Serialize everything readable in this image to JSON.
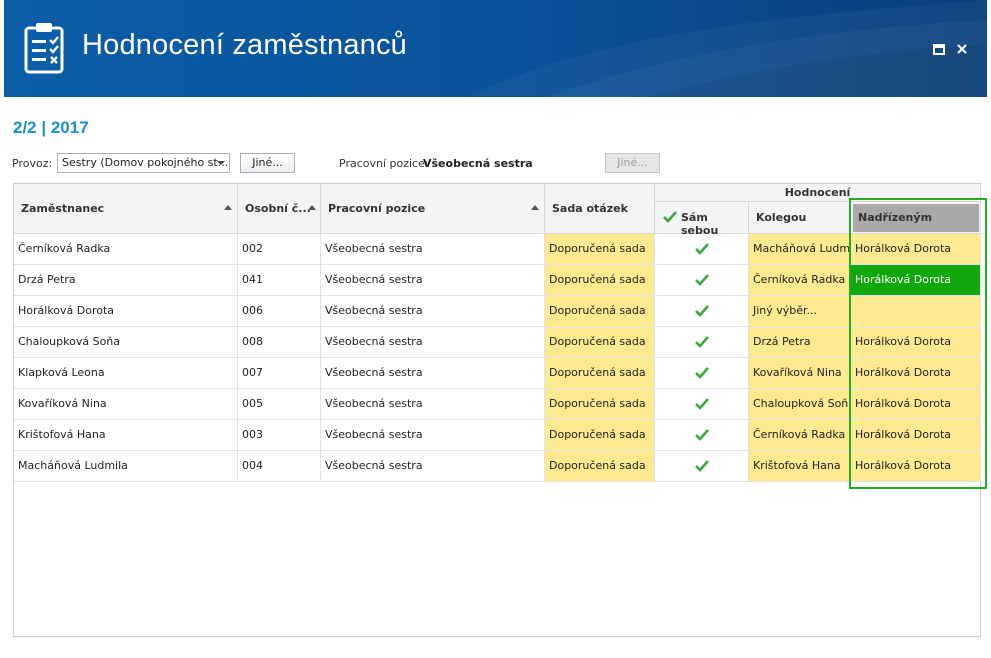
{
  "window": {
    "title": "Hodnocení zaměstnanců",
    "icon": "clipboard-checklist-icon",
    "maximize_icon": "maximize-icon",
    "close_icon": "close-icon"
  },
  "period": "2/2 | 2017",
  "filters": {
    "provoz_label": "Provoz:",
    "provoz_value": "Sestry (Domov pokojného st...",
    "provoz_other_button": "Jiné...",
    "position_label": "Pracovní pozice:",
    "position_value": "Všeobecná sestra",
    "position_other_button": "Jiné..."
  },
  "grid": {
    "headers": {
      "employee": "Zaměstnanec",
      "personal_no": "Osobní č...",
      "position": "Pracovní pozice",
      "question_set": "Sada otázek",
      "evaluation_group": "Hodnocení",
      "self": "Sám sebou",
      "colleague": "Kolegou",
      "supervisor": "Nadřízeným"
    },
    "rows": [
      {
        "employee": "Černíková Radka",
        "no": "002",
        "position": "Všeobecná sestra",
        "set": "Doporučená sada",
        "self": true,
        "colleague": "Macháňová Ludmila",
        "supervisor": "Horálková Dorota"
      },
      {
        "employee": "Drzá Petra",
        "no": "041",
        "position": "Všeobecná sestra",
        "set": "Doporučená sada",
        "self": true,
        "colleague": "Černíková Radka",
        "supervisor": "Horálková Dorota"
      },
      {
        "employee": "Horálková Dorota",
        "no": "006",
        "position": "Všeobecná sestra",
        "set": "Doporučená sada",
        "self": true,
        "colleague": "Jiný výběr...",
        "supervisor": ""
      },
      {
        "employee": "Chaloupková Soňa",
        "no": "008",
        "position": "Všeobecná sestra",
        "set": "Doporučená sada",
        "self": true,
        "colleague": "Drzá Petra",
        "supervisor": "Horálková Dorota"
      },
      {
        "employee": "Klapková Leona",
        "no": "007",
        "position": "Všeobecná sestra",
        "set": "Doporučená sada",
        "self": true,
        "colleague": "Kovaříková Nina",
        "supervisor": "Horálková Dorota"
      },
      {
        "employee": "Kovaříková Nina",
        "no": "005",
        "position": "Všeobecná sestra",
        "set": "Doporučená sada",
        "self": true,
        "colleague": "Chaloupková Soňa",
        "supervisor": "Horálková Dorota"
      },
      {
        "employee": "Krištofová Hana",
        "no": "003",
        "position": "Všeobecná sestra",
        "set": "Doporučená sada",
        "self": true,
        "colleague": "Černíková Radka",
        "supervisor": "Horálková Dorota"
      },
      {
        "employee": "Macháňová Ludmila",
        "no": "004",
        "position": "Všeobecná sestra",
        "set": "Doporučená sada",
        "self": true,
        "colleague": "Krištofová Hana",
        "supervisor": "Horálková Dorota"
      }
    ],
    "selected_row_index": 1,
    "selected_column": "supervisor"
  },
  "colors": {
    "header_blue": "#0a5197",
    "accent_text": "#1b8fd1",
    "cell_yellow": "#fde98f",
    "selected_green": "#11a80e",
    "highlight_border": "#1fae24",
    "check_green": "#3aa83a"
  }
}
